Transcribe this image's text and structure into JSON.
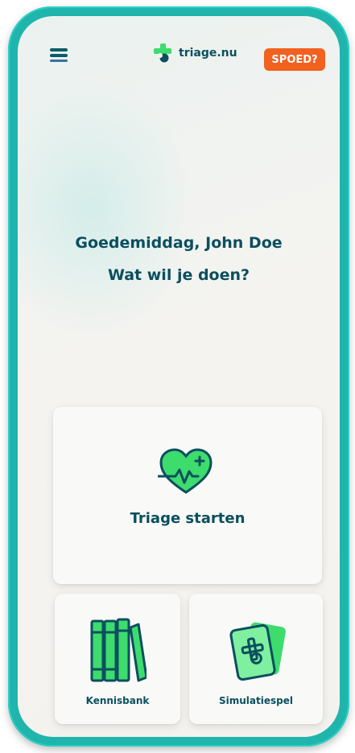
{
  "header": {
    "menu_icon": "hamburger-menu-icon",
    "brand_icon": "triage-cross-logo-icon",
    "brand_name": "triage.nu",
    "emergency_label": "SPOED?"
  },
  "greeting": {
    "line1": "Goedemiddag, John Doe",
    "line2": "Wat wil je doen?"
  },
  "actions": {
    "triage": {
      "label": "Triage starten",
      "icon": "heart-pulse-icon"
    },
    "knowledge": {
      "label": "Kennisbank",
      "icon": "books-icon"
    },
    "simulation": {
      "label": "Simulatiespel",
      "icon": "cards-icon"
    }
  },
  "colors": {
    "frame": "#1fb5ad",
    "text_primary": "#0b4f5e",
    "accent_green": "#3ddc6d",
    "emergency_orange": "#f2611f"
  }
}
